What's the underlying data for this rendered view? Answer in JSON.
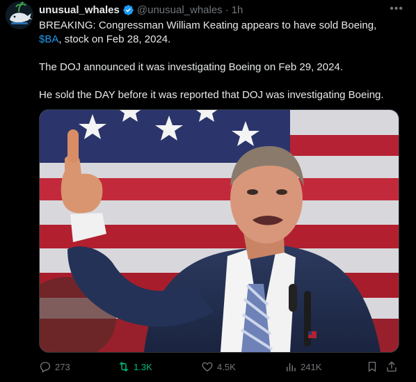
{
  "author": {
    "display_name": "unusual_whales",
    "handle": "@unusual_whales",
    "separator": "·",
    "time": "1h"
  },
  "tweet": {
    "line1_prefix": "BREAKING: Congressman William Keating appears to have sold Boeing,",
    "cashtag": "$BA",
    "line1_suffix": ", stock on Feb 28, 2024.",
    "paragraph2": "The DOJ announced it was investigating Boeing on Feb 29, 2024.",
    "paragraph3": "He sold the DAY before it was reported that DOJ was investigating Boeing."
  },
  "media": {
    "alt_subject": "photo-man-thumbs-up-flag"
  },
  "actions": {
    "replies": "273",
    "retweets": "1.3K",
    "likes": "4.5K",
    "views": "241K"
  },
  "colors": {
    "background": "#000000",
    "text": "#e7e9ea",
    "muted": "#71767b",
    "link": "#1d9bf0",
    "retweet_green": "#00ba7c"
  },
  "icons": {
    "reply": "comment-icon",
    "retweet": "retweet-icon",
    "like": "heart-icon",
    "views": "bar-chart-icon",
    "bookmark": "bookmark-icon",
    "share": "share-icon",
    "more": "more-horizontal-icon",
    "verified": "verified-badge-icon"
  }
}
